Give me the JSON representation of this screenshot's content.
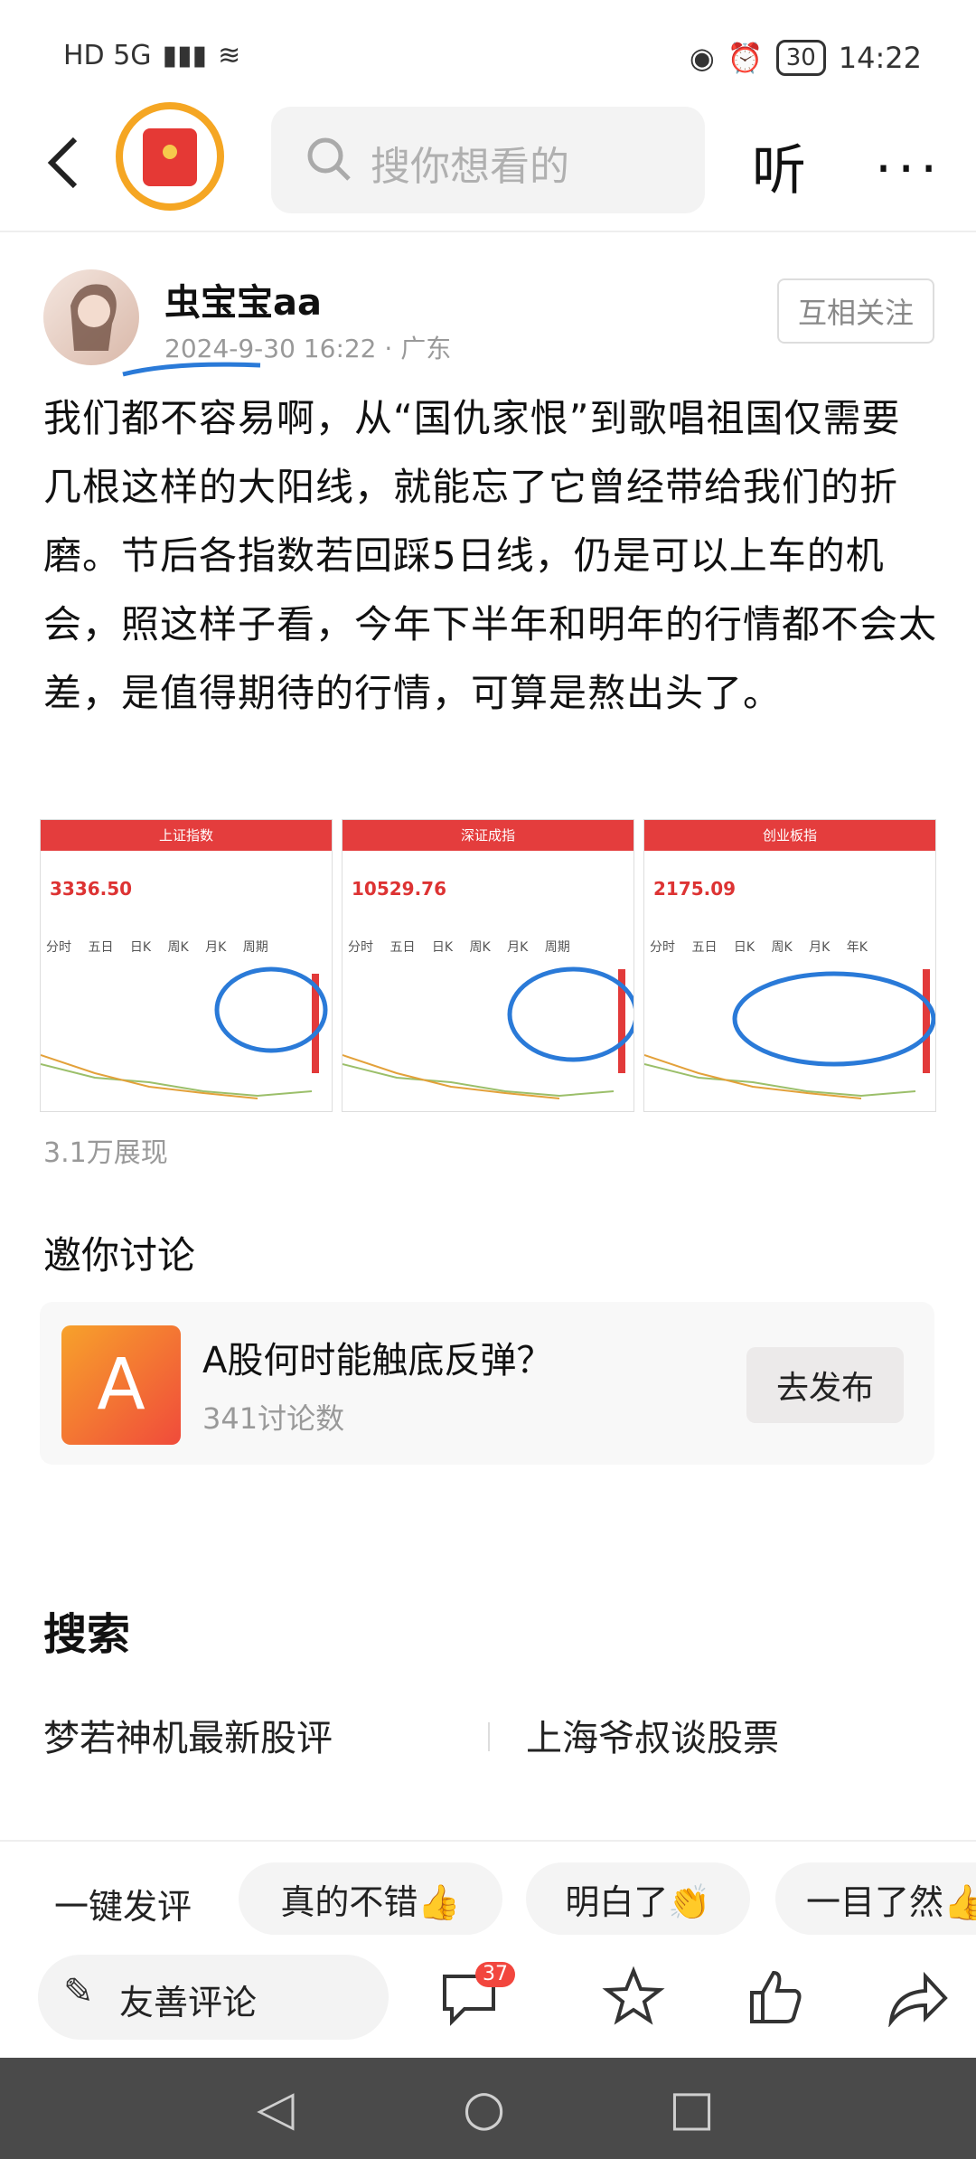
{
  "status": {
    "signal": "HD 5G",
    "battery": "30",
    "time": "14:22"
  },
  "nav": {
    "back_icon": "chevron-left-icon",
    "search_placeholder": "搜你想看的",
    "listen_label": "听",
    "more_label": "···"
  },
  "post": {
    "author": "虫宝宝aa",
    "meta": "2024-9-30 16:22 · 广东",
    "follow_label": "互相关注",
    "content": "我们都不容易啊，从“国仇家恨”到歌唱祖国仅需要几根这样的大阳线，就能忘了它曾经带给我们的折磨。节后各指数若回踩5日线，仍是可以上车的机会，照这样子看，今年下半年和明年的行情都不会太差，是值得期待的行情，可算是熬出头了。",
    "images": [
      {
        "title": "上证指数",
        "price": "3336.50",
        "tabs": "分时 五日 日K 周K 月K 周期"
      },
      {
        "title": "深证成指",
        "price": "10529.76",
        "tabs": "分时 五日 日K 周K 月K 周期"
      },
      {
        "title": "创业板指",
        "price": "2175.09",
        "tabs": "分时 五日 日K 周K 月K 年K"
      }
    ],
    "views": "3.1万展现"
  },
  "invite": {
    "heading": "邀你讨论",
    "topic_letter": "A",
    "topic_title": "A股何时能触底反弹？",
    "topic_count": "341讨论数",
    "publish_label": "去发布"
  },
  "search": {
    "heading": "搜索",
    "suggestions": [
      "梦若神机最新股评",
      "上海爷叔谈股票"
    ]
  },
  "quick_comments": {
    "label": "一键发评",
    "chips": [
      "真的不错👍",
      "明白了👏",
      "一目了然👍"
    ]
  },
  "bottom_bar": {
    "comment_placeholder": "友善评论",
    "comment_count": "37"
  }
}
